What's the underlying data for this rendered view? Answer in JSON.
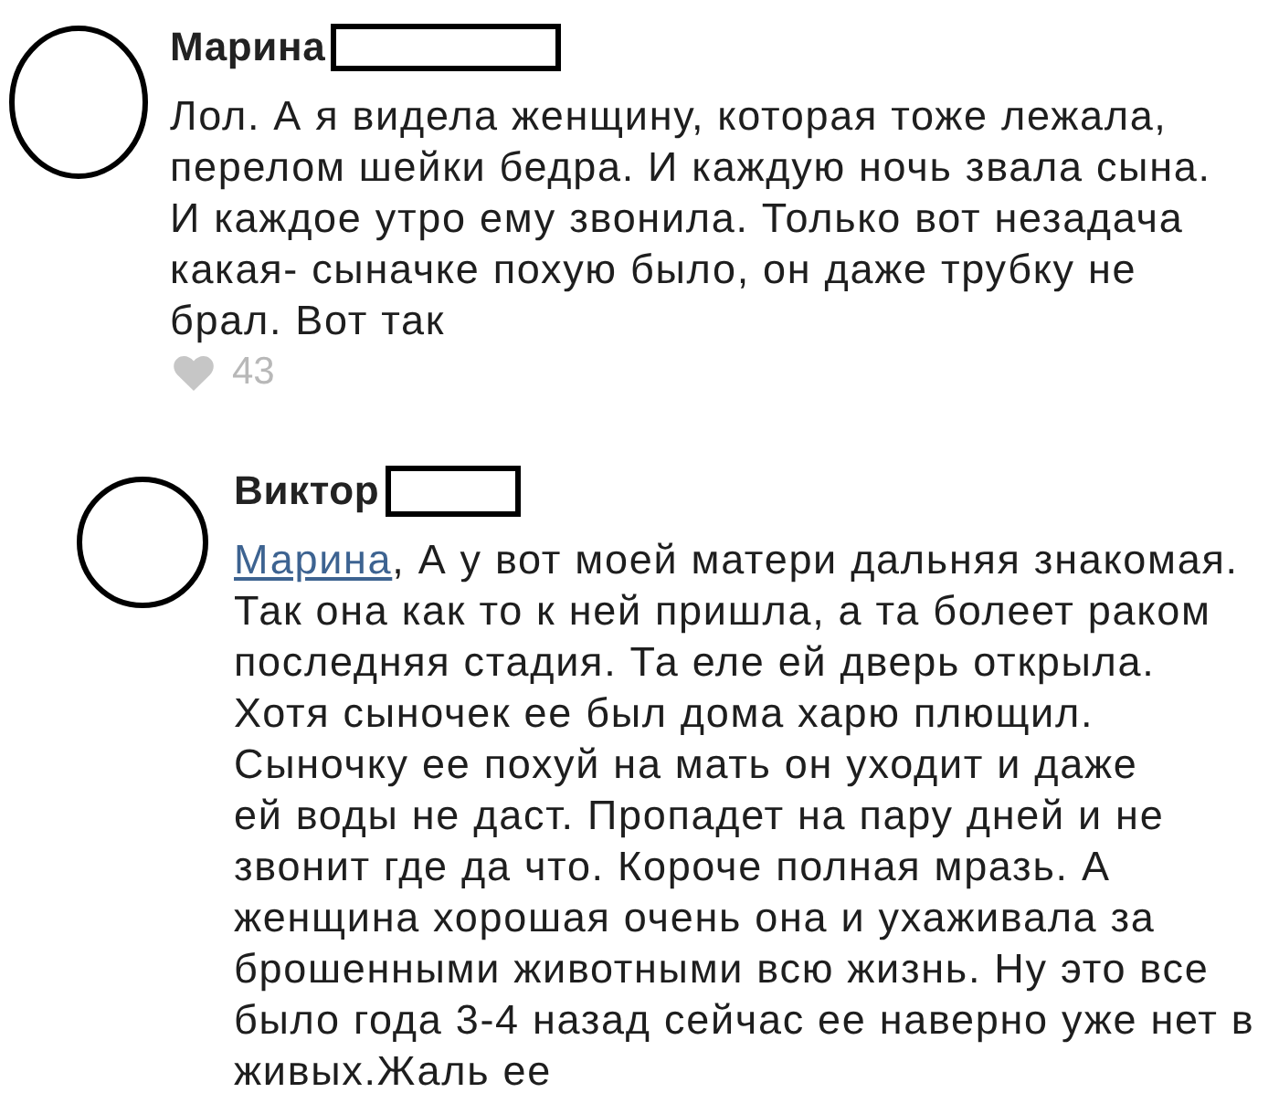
{
  "comments": [
    {
      "author": "Марина",
      "text": "Лол. А я видела женщину, которая тоже лежала,\nперелом шейки бедра. И каждую ночь звала сына.\nИ каждое утро ему звонила. Только вот незадача\nкакая- сыначке похую было, он даже трубку не\nбрал. Вот так",
      "likes": "43",
      "children": [
        {
          "author": "Виктор",
          "mention": "Марина",
          "text": ", А у вот моей матери дальняя знакомая.\nТак она как то к ней пришла, а та болеет раком\nпоследняя стадия. Та еле ей дверь открыла.\nХотя сыночек ее был дома харю плющил.\nСыночку ее похуй на мать он уходит и даже\nей воды не даст. Пропадет на пару дней и не\nзвонит где да что. Короче полная мразь. А\nженщина хорошая очень она и ухаживала за\nброшенными животными всю жизнь. Ну это все\nбыло года 3-4 назад сейчас ее наверно уже нет в\nживых.Жаль ее"
        }
      ]
    }
  ]
}
